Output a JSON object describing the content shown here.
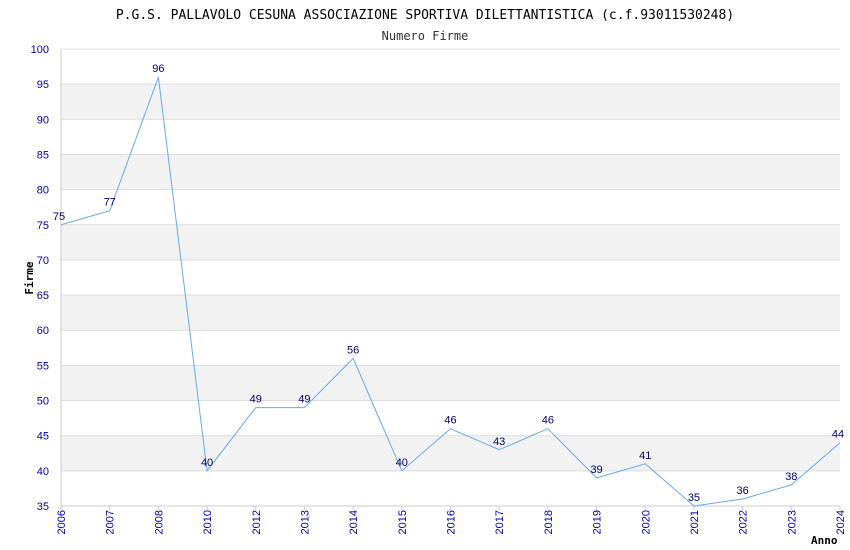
{
  "chart_data": {
    "type": "line",
    "title": "P.G.S. PALLAVOLO CESUNA ASSOCIAZIONE SPORTIVA DILETTANTISTICA (c.f.93011530248)",
    "subtitle": "Numero Firme",
    "xlabel": "Anno",
    "ylabel": "Firme",
    "ylim": [
      35,
      100
    ],
    "yticks": [
      35,
      40,
      45,
      50,
      55,
      60,
      65,
      70,
      75,
      80,
      85,
      90,
      95,
      100
    ],
    "grid": true,
    "legend": "none",
    "categories": [
      "2006",
      "2007",
      "2008",
      "2010",
      "2012",
      "2013",
      "2014",
      "2015",
      "2016",
      "2017",
      "2018",
      "2019",
      "2020",
      "2021",
      "2022",
      "2023",
      "2024"
    ],
    "series": [
      {
        "values": [
          75,
          77,
          96,
          40,
          49,
          49,
          56,
          40,
          46,
          43,
          46,
          39,
          41,
          35,
          36,
          38,
          44
        ]
      }
    ],
    "colors": {
      "line": "#66aaee",
      "band_alt": "#f2f2f2",
      "band": "#ffffff",
      "gridline": "#dddddd",
      "axis": "#cccccc",
      "tick_text": "#0000aa",
      "data_label": "#000066"
    }
  }
}
